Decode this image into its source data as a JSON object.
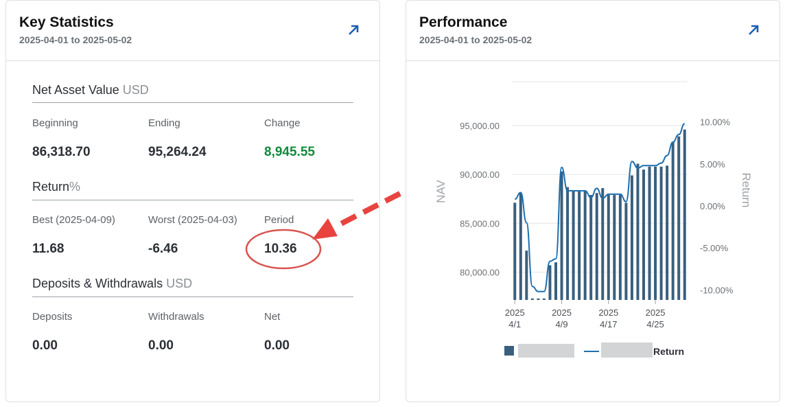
{
  "key_statistics": {
    "title": "Key Statistics",
    "date_range": "2025-04-01 to 2025-05-02",
    "nav": {
      "title": "Net Asset Value",
      "unit": "USD",
      "beginning_label": "Beginning",
      "beginning_value": "86,318.70",
      "ending_label": "Ending",
      "ending_value": "95,264.24",
      "change_label": "Change",
      "change_value": "8,945.55"
    },
    "return": {
      "title": "Return",
      "unit": "%",
      "best_label": "Best (2025-04-09)",
      "best_value": "11.68",
      "worst_label": "Worst (2025-04-03)",
      "worst_value": "-6.46",
      "period_label": "Period",
      "period_value": "10.36"
    },
    "deposits": {
      "title": "Deposits & Withdrawals",
      "unit": "USD",
      "deposits_label": "Deposits",
      "deposits_value": "0.00",
      "withdrawals_label": "Withdrawals",
      "withdrawals_value": "0.00",
      "net_label": "Net",
      "net_value": "0.00"
    }
  },
  "performance": {
    "title": "Performance",
    "date_range": "2025-04-01 to 2025-05-02"
  },
  "annotation": {
    "arrow_color": "#e8433f",
    "circle_color": "#d9534f"
  },
  "chart_data": {
    "type": "bar",
    "x_ticks": [
      {
        "year": "2025",
        "day": "4/1"
      },
      {
        "year": "2025",
        "day": "4/9"
      },
      {
        "year": "2025",
        "day": "4/17"
      },
      {
        "year": "2025",
        "day": "4/25"
      }
    ],
    "ylabel_left": "NAV",
    "ylabel_right": "Return",
    "y_left_ticks": [
      "95,000.00",
      "90,000.00",
      "85,000.00",
      "80,000.00"
    ],
    "y_right_ticks": [
      "10.00%",
      "5.00%",
      "0.00%",
      "-5.00%",
      "-10.00%"
    ],
    "ylim_left": [
      77150,
      99500
    ],
    "ylim_right": [
      -11.2,
      14.8
    ],
    "nav_values": [
      87100,
      88100,
      82200,
      77300,
      77300,
      77300,
      80700,
      81000,
      90300,
      88700,
      88300,
      88300,
      88300,
      87900,
      88100,
      88600,
      87900,
      87900,
      87900,
      87100,
      89900,
      91100,
      90500,
      90800,
      90800,
      90800,
      90900,
      93300,
      93900,
      94600
    ],
    "return_values": [
      0.8,
      1.6,
      -2.0,
      -9.6,
      -10.2,
      -10.2,
      -6.6,
      -6.3,
      4.6,
      1.8,
      1.8,
      1.8,
      1.8,
      1.0,
      2.1,
      0.9,
      1.4,
      1.4,
      1.4,
      0.5,
      5.3,
      4.5,
      4.8,
      4.8,
      4.8,
      5.1,
      6.0,
      7.6,
      8.5,
      9.8
    ],
    "series": [
      {
        "name": "",
        "type": "bar",
        "color": "#3a5f7d"
      },
      {
        "name": "Return",
        "type": "line",
        "color": "#1c6fb0"
      }
    ],
    "legend_placement": "bottom",
    "grid": true
  }
}
